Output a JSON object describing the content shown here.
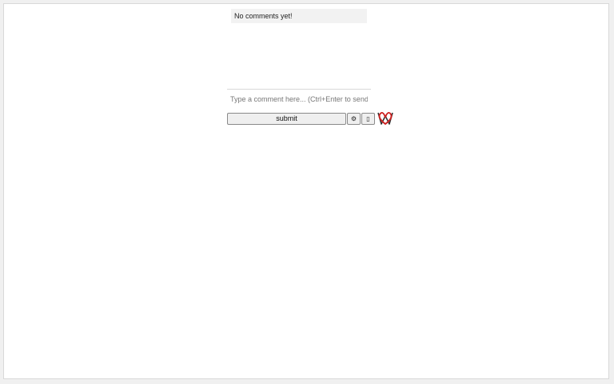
{
  "comments": {
    "empty_message": "No comments yet!"
  },
  "composer": {
    "placeholder": "Type a comment here... (Ctrl+Enter to send)",
    "value": ""
  },
  "toolbar": {
    "submit_label": "submit",
    "settings_glyph": "⚙",
    "extra_glyph": "▯"
  },
  "colors": {
    "logo_red": "#cc1f1f",
    "logo_dark": "#333333"
  }
}
